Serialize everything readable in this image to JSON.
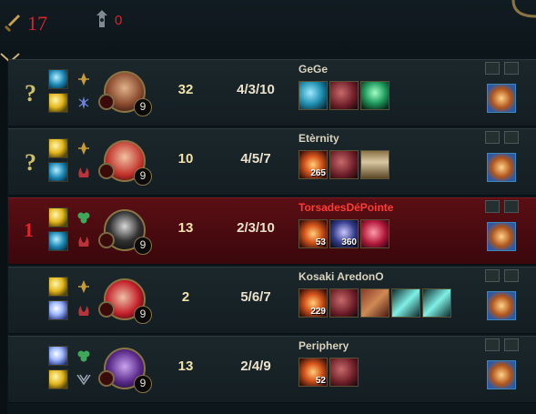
{
  "header": {
    "kills": "17",
    "towers": "0",
    "icons": [
      "sword-icon",
      "tower-icon"
    ]
  },
  "players": [
    {
      "rank": "?",
      "rank_type": "question",
      "name": "GeGe",
      "name_color": "#d9d2bd",
      "cs": "32",
      "kda": "4/3/10",
      "level": "9",
      "spells": [
        "ghost",
        "flash"
      ],
      "runes": [
        "precision-rune-icon",
        "sorcery-rune-icon"
      ],
      "items": [
        {
          "icon": "crystal-item-icon",
          "count": ""
        },
        {
          "icon": "boots-item-icon",
          "count": ""
        },
        {
          "icon": "potion-item-icon",
          "count": ""
        }
      ]
    },
    {
      "rank": "?",
      "rank_type": "question",
      "name": "Etèrnity",
      "name_color": "#d9d2bd",
      "cs": "10",
      "kda": "4/5/7",
      "level": "9",
      "spells": [
        "flash",
        "ghost"
      ],
      "runes": [
        "precision-rune-icon",
        "domination-rune-icon"
      ],
      "items": [
        {
          "icon": "dark-seal-item-icon",
          "count": "265"
        },
        {
          "icon": "boots-item-icon",
          "count": ""
        },
        {
          "icon": "belt-item-icon",
          "count": ""
        }
      ]
    },
    {
      "rank": "1",
      "rank_type": "number",
      "name": "TorsadesDéPointe",
      "name_color": "#ff3a33",
      "cs": "13",
      "kda": "2/3/10",
      "level": "9",
      "spells": [
        "flash",
        "ghost"
      ],
      "runes": [
        "resolve-rune-icon",
        "domination-rune-icon"
      ],
      "items": [
        {
          "icon": "dark-seal-item-icon",
          "count": "53"
        },
        {
          "icon": "mejai-item-icon",
          "count": "360"
        },
        {
          "icon": "gem-item-icon",
          "count": ""
        }
      ]
    },
    {
      "rank": "",
      "rank_type": "none",
      "name": "Kosaki AredonO",
      "name_color": "#d9d2bd",
      "cs": "2",
      "kda": "5/6/7",
      "level": "9",
      "spells": [
        "flash",
        "barrier"
      ],
      "runes": [
        "precision-rune-icon",
        "domination-rune-icon"
      ],
      "items": [
        {
          "icon": "dark-seal-item-icon",
          "count": "229"
        },
        {
          "icon": "boots-item-icon",
          "count": ""
        },
        {
          "icon": "tome-item-icon",
          "count": ""
        },
        {
          "icon": "blade-item-icon",
          "count": ""
        },
        {
          "icon": "blade-item-icon",
          "count": ""
        }
      ]
    },
    {
      "rank": "",
      "rank_type": "none",
      "name": "Periphery",
      "name_color": "#d9d2bd",
      "cs": "13",
      "kda": "2/4/9",
      "level": "9",
      "spells": [
        "barrier",
        "flash"
      ],
      "runes": [
        "resolve-rune-icon",
        "inspiration-rune-icon"
      ],
      "items": [
        {
          "icon": "dark-seal-item-icon",
          "count": "52"
        },
        {
          "icon": "boots-item-icon",
          "count": ""
        }
      ]
    }
  ],
  "colors": {
    "accent_gold": "#cfc065",
    "kill_red": "#d8242a",
    "highlight_row": "#5a0f14"
  }
}
